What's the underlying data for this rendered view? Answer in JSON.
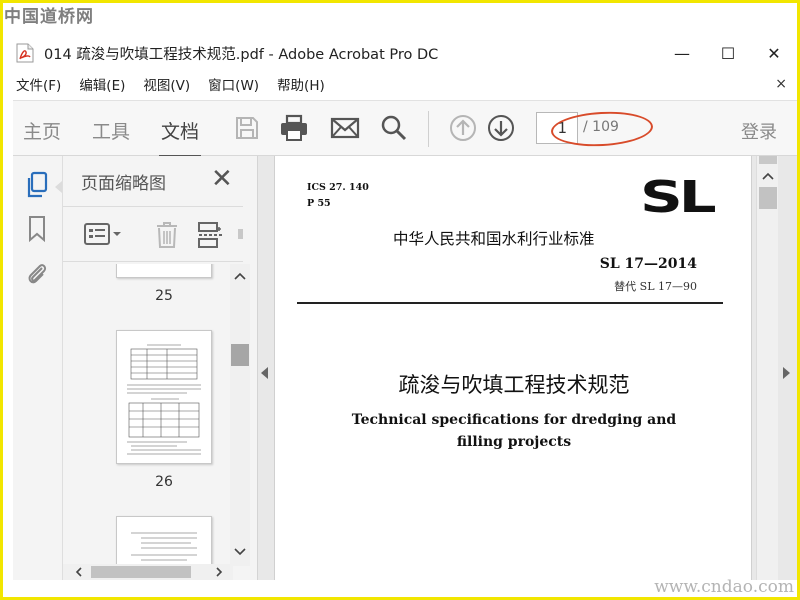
{
  "watermark": {
    "top": "中国道桥网",
    "bottom": "www.cndao.com"
  },
  "window": {
    "title": "014  疏浚与吹填工程技术规范.pdf - Adobe Acrobat Pro DC",
    "minimize": "—",
    "maximize": "☐",
    "close": "✕"
  },
  "menu": {
    "items": [
      "文件(F)",
      "编辑(E)",
      "视图(V)",
      "窗口(W)",
      "帮助(H)"
    ],
    "close": "×"
  },
  "toolbar": {
    "tabs": [
      "主页",
      "工具",
      "文档"
    ],
    "active_tab": "文档",
    "page_current": "1",
    "page_total": "/ 109",
    "login": "登录"
  },
  "thumb_panel": {
    "title": "页面缩略图",
    "close": "✕",
    "pages": [
      "25",
      "26"
    ]
  },
  "document": {
    "ics": "ICS 27. 140",
    "pcode": "P 55",
    "logo": "SL",
    "standard_title": "中华人民共和国水利行业标准",
    "standard_no": "SL 17—2014",
    "replaces": "替代 SL 17—90",
    "title_cn": "疏浚与吹填工程技术规范",
    "title_en_1": "Technical specifications for dredging and",
    "title_en_2": "filling projects"
  },
  "colors": {
    "frame": "#f2e600",
    "annotation": "#d84b2a",
    "acrobat_red": "#d6301f",
    "nav_blue": "#2a6ebb"
  }
}
